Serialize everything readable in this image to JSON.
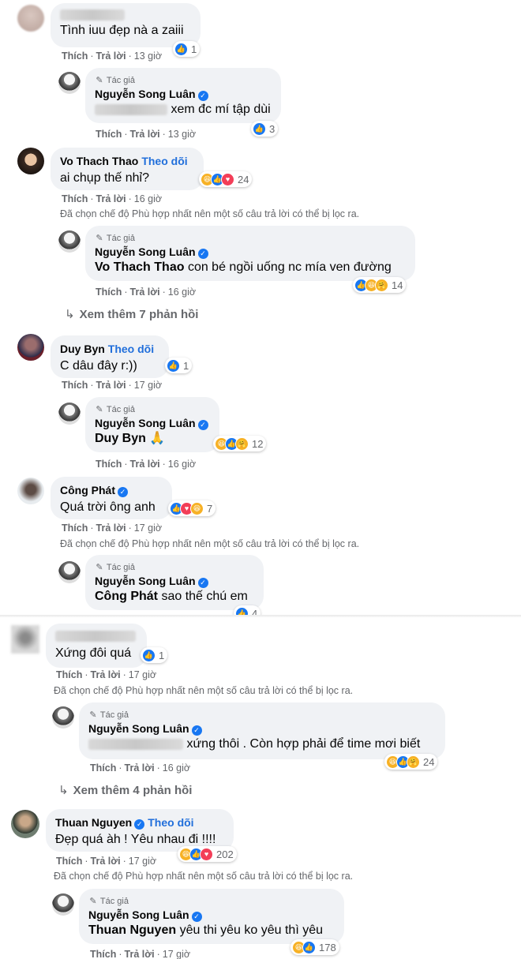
{
  "labels": {
    "like": "Thích",
    "reply": "Trả lời",
    "author_tag": "Tác giả",
    "follow": "Theo dõi",
    "filter_notice": "Đã chọn chế độ Phù hợp nhất nên một số câu trả lời có thể bị lọc ra."
  },
  "comments": [
    {
      "name": "",
      "text": "Tình iuu đẹp nà a zaiii",
      "time": "13 giờ",
      "reactions": [
        "like"
      ],
      "count": "1"
    },
    {
      "name": "Nguyễn Song Luân",
      "text": "xem đc mí tập dùi",
      "time": "13 giờ",
      "reactions": [
        "like"
      ],
      "count": "3"
    },
    {
      "name": "Vo Thach Thao",
      "text": "ai chụp thế nhỉ?",
      "time": "16 giờ",
      "reactions": [
        "haha",
        "like",
        "love"
      ],
      "count": "24"
    },
    {
      "name": "Nguyễn Song Luân",
      "tag": "Vo Thach Thao",
      "text": "con bé ngồi uống nc mía ven đường",
      "time": "16 giờ",
      "reactions": [
        "like",
        "haha",
        "haha"
      ],
      "count": "14"
    },
    {
      "name": "Duy Byn",
      "text": "C dâu đây r:))",
      "time": "17 giờ",
      "reactions": [
        "like"
      ],
      "count": "1"
    },
    {
      "name": "Nguyễn Song Luân",
      "tag": "Duy Byn",
      "text": "🙏",
      "time": "16 giờ",
      "reactions": [
        "haha",
        "like",
        "haha"
      ],
      "count": "12"
    },
    {
      "name": "Công Phát",
      "text": "Quá trời ông anh",
      "time": "17 giờ",
      "reactions": [
        "like",
        "love",
        "haha"
      ],
      "count": "7"
    },
    {
      "name": "Nguyễn Song Luân",
      "tag": "Công Phát",
      "text": "sao thế chú em",
      "reactions": [
        "like"
      ],
      "count": "4"
    },
    {
      "name": "",
      "text": "Xứng đôi quá",
      "time": "17 giờ",
      "reactions": [
        "like"
      ],
      "count": "1"
    },
    {
      "name": "Nguyễn Song Luân",
      "text": "xứng thôi . Còn hợp phải để time mơi biết",
      "time": "16 giờ",
      "reactions": [
        "haha",
        "like",
        "haha"
      ],
      "count": "24"
    },
    {
      "name": "Thuan Nguyen",
      "text": "Đẹp quá àh ! Yêu nhau đi !!!!",
      "time": "17 giờ",
      "reactions": [
        "haha",
        "like",
        "love"
      ],
      "count": "202"
    },
    {
      "name": "Nguyễn Song Luân",
      "tag": "Thuan Nguyen",
      "text": "yêu thi yêu ko yêu thì yêu",
      "time": "17 giờ",
      "reactions": [
        "haha",
        "like"
      ],
      "count": "178"
    }
  ],
  "more_replies": [
    "Xem thêm 7 phản hồi",
    "Xem thêm 4 phản hồi"
  ]
}
